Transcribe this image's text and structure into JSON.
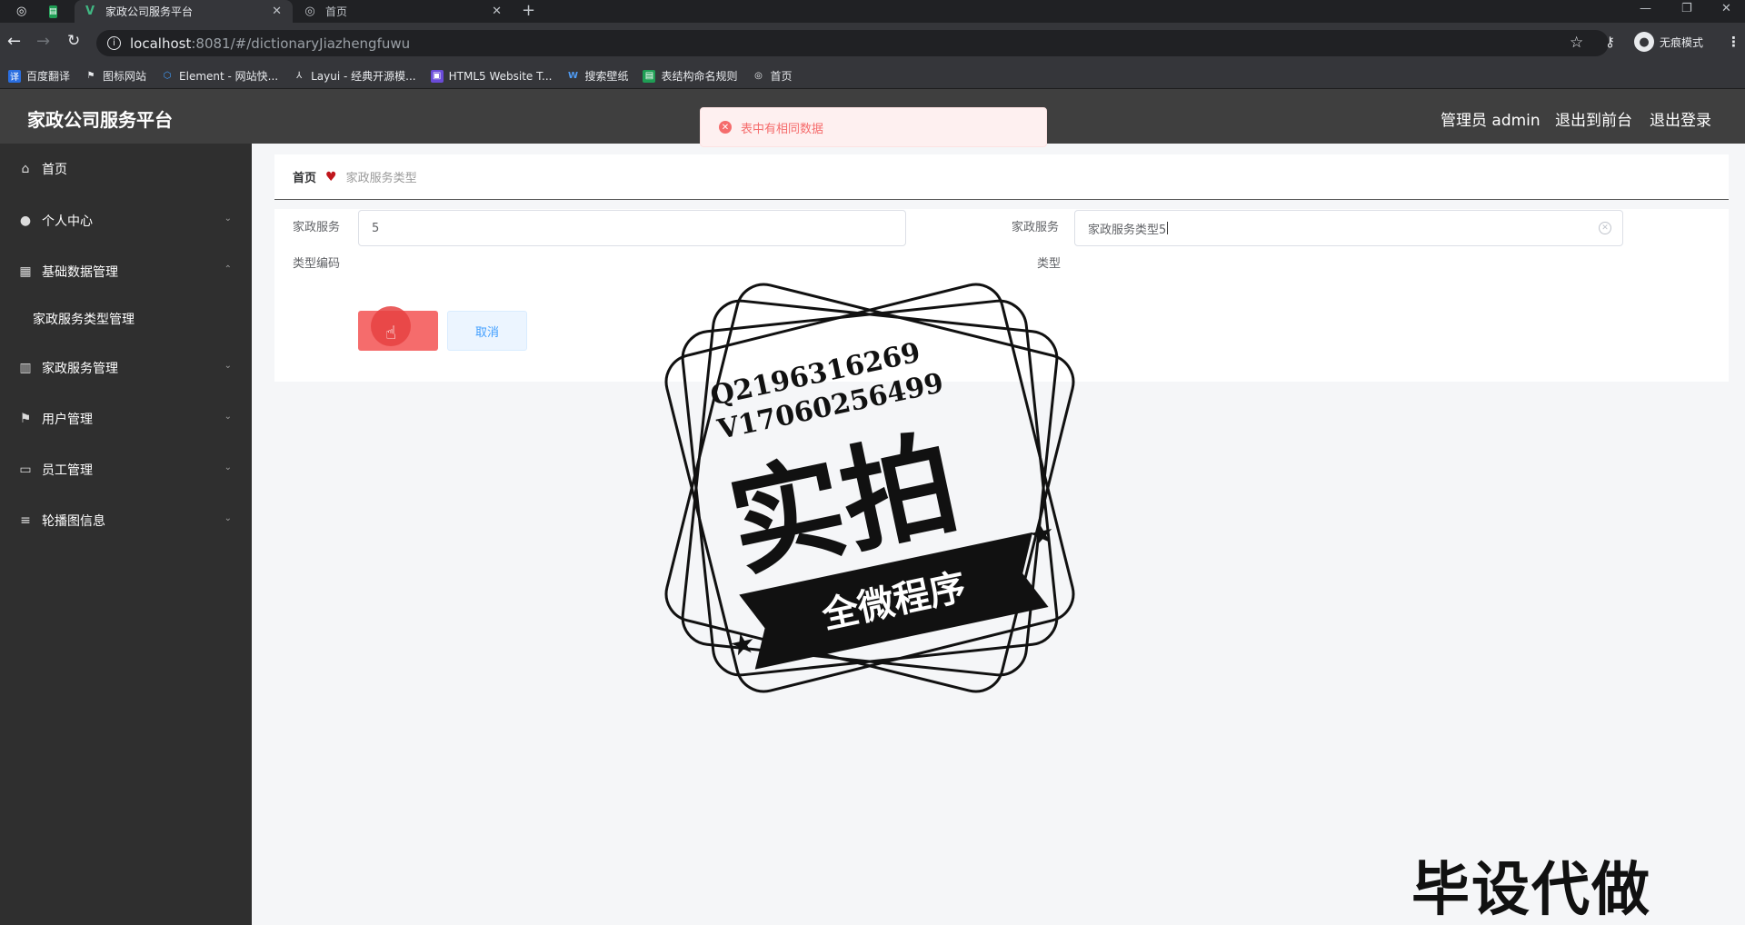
{
  "browser": {
    "tabs": [
      {
        "title": "家政公司服务平台",
        "active": true
      },
      {
        "title": "首页",
        "active": false
      }
    ],
    "url_host": "localhost",
    "url_rest": ":8081/#/dictionaryJiazhengfuwu",
    "profile_label": "无痕模式",
    "bookmarks": [
      {
        "label": "百度翻译",
        "color": "#2a6ee0"
      },
      {
        "label": "图标网站",
        "color": "#444444"
      },
      {
        "label": "Element - 网站快...",
        "color": "#409eff"
      },
      {
        "label": "Layui - 经典开源模...",
        "color": "#555555"
      },
      {
        "label": "HTML5 Website T...",
        "color": "#6a4bd8"
      },
      {
        "label": "搜索壁纸",
        "color": "#1f6fd6"
      },
      {
        "label": "表结构命名规则",
        "color": "#1f9e55"
      },
      {
        "label": "首页",
        "color": "#666666"
      }
    ]
  },
  "header": {
    "title": "家政公司服务平台",
    "admin_label": "管理员 admin",
    "to_front_label": "退出到前台",
    "logout_label": "退出登录"
  },
  "sidebar": {
    "items": [
      {
        "label": "首页",
        "icon": "home-icon"
      },
      {
        "label": "个人中心",
        "icon": "user-icon"
      },
      {
        "label": "基础数据管理",
        "icon": "grid-icon"
      },
      {
        "label": "家政服务类型管理",
        "icon": ""
      },
      {
        "label": "家政服务管理",
        "icon": "chart-icon"
      },
      {
        "label": "用户管理",
        "icon": "flag-icon"
      },
      {
        "label": "员工管理",
        "icon": "card-icon"
      },
      {
        "label": "轮播图信息",
        "icon": "list-icon"
      }
    ]
  },
  "breadcrumb": {
    "home": "首页",
    "current": "家政服务类型"
  },
  "form": {
    "code_label_line1": "家政服务",
    "code_label_line2": "类型编码",
    "code_value": "5",
    "type_label_line1": "家政服务",
    "type_label_line2": "类型",
    "type_value": "家政服务类型5",
    "cancel_label": "取消"
  },
  "toast": {
    "message": "表中有相同数据"
  },
  "watermark": {
    "line1": "Q2196316269",
    "line2": "V17060256499",
    "big": "实拍",
    "banner": "全微程序",
    "bottom": "毕设代做"
  },
  "colors": {
    "header_bg": "#3f3f3f",
    "sidebar_bg": "#2f2f2f",
    "submit_btn": "#f56c6c",
    "breadcrumb_heart": "#c0161c",
    "toast_text": "#f56c6c"
  }
}
